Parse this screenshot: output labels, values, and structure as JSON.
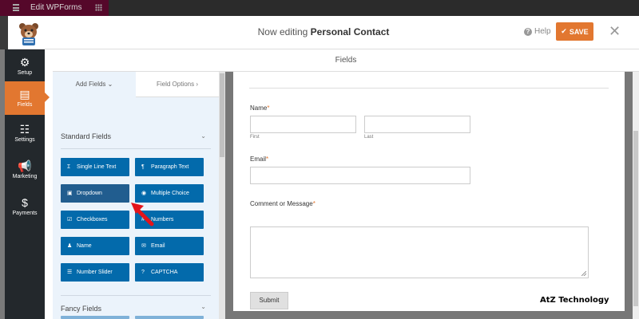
{
  "background": {
    "tab_title": "Edit WPForms"
  },
  "header": {
    "title_prefix": "Now editing",
    "form_name": "Personal Contact",
    "help_label": "Help",
    "save_label": "SAVE",
    "close_glyph": "✕"
  },
  "nav": {
    "items": [
      {
        "label": "Setup",
        "icon": "gear-icon"
      },
      {
        "label": "Fields",
        "icon": "list-icon"
      },
      {
        "label": "Settings",
        "icon": "sliders-icon"
      },
      {
        "label": "Marketing",
        "icon": "megaphone-icon"
      },
      {
        "label": "Payments",
        "icon": "dollar-icon"
      }
    ]
  },
  "fields_bar": {
    "title": "Fields"
  },
  "panel": {
    "tab_add": "Add Fields",
    "tab_options": "Field Options",
    "standard_title": "Standard Fields",
    "fancy_title": "Fancy Fields",
    "buttons": [
      {
        "label": "Single Line Text",
        "icon": "text-cursor-icon"
      },
      {
        "label": "Paragraph Text",
        "icon": "paragraph-icon"
      },
      {
        "label": "Dropdown",
        "icon": "dropdown-icon"
      },
      {
        "label": "Multiple Choice",
        "icon": "radio-icon"
      },
      {
        "label": "Checkboxes",
        "icon": "checkbox-icon"
      },
      {
        "label": "Numbers",
        "icon": "hash-icon"
      },
      {
        "label": "Name",
        "icon": "user-icon"
      },
      {
        "label": "Email",
        "icon": "envelope-icon"
      },
      {
        "label": "Number Slider",
        "icon": "slider-icon"
      },
      {
        "label": "CAPTCHA",
        "icon": "question-icon"
      }
    ]
  },
  "form": {
    "name_label": "Name",
    "first_sub": "First",
    "last_sub": "Last",
    "email_label": "Email",
    "comment_label": "Comment or Message",
    "required_mark": "*",
    "submit_label": "Submit"
  },
  "watermark": "AtZ Technology",
  "colors": {
    "accent": "#e27730",
    "field_button": "#036aab",
    "nav_bg": "#23282c"
  }
}
